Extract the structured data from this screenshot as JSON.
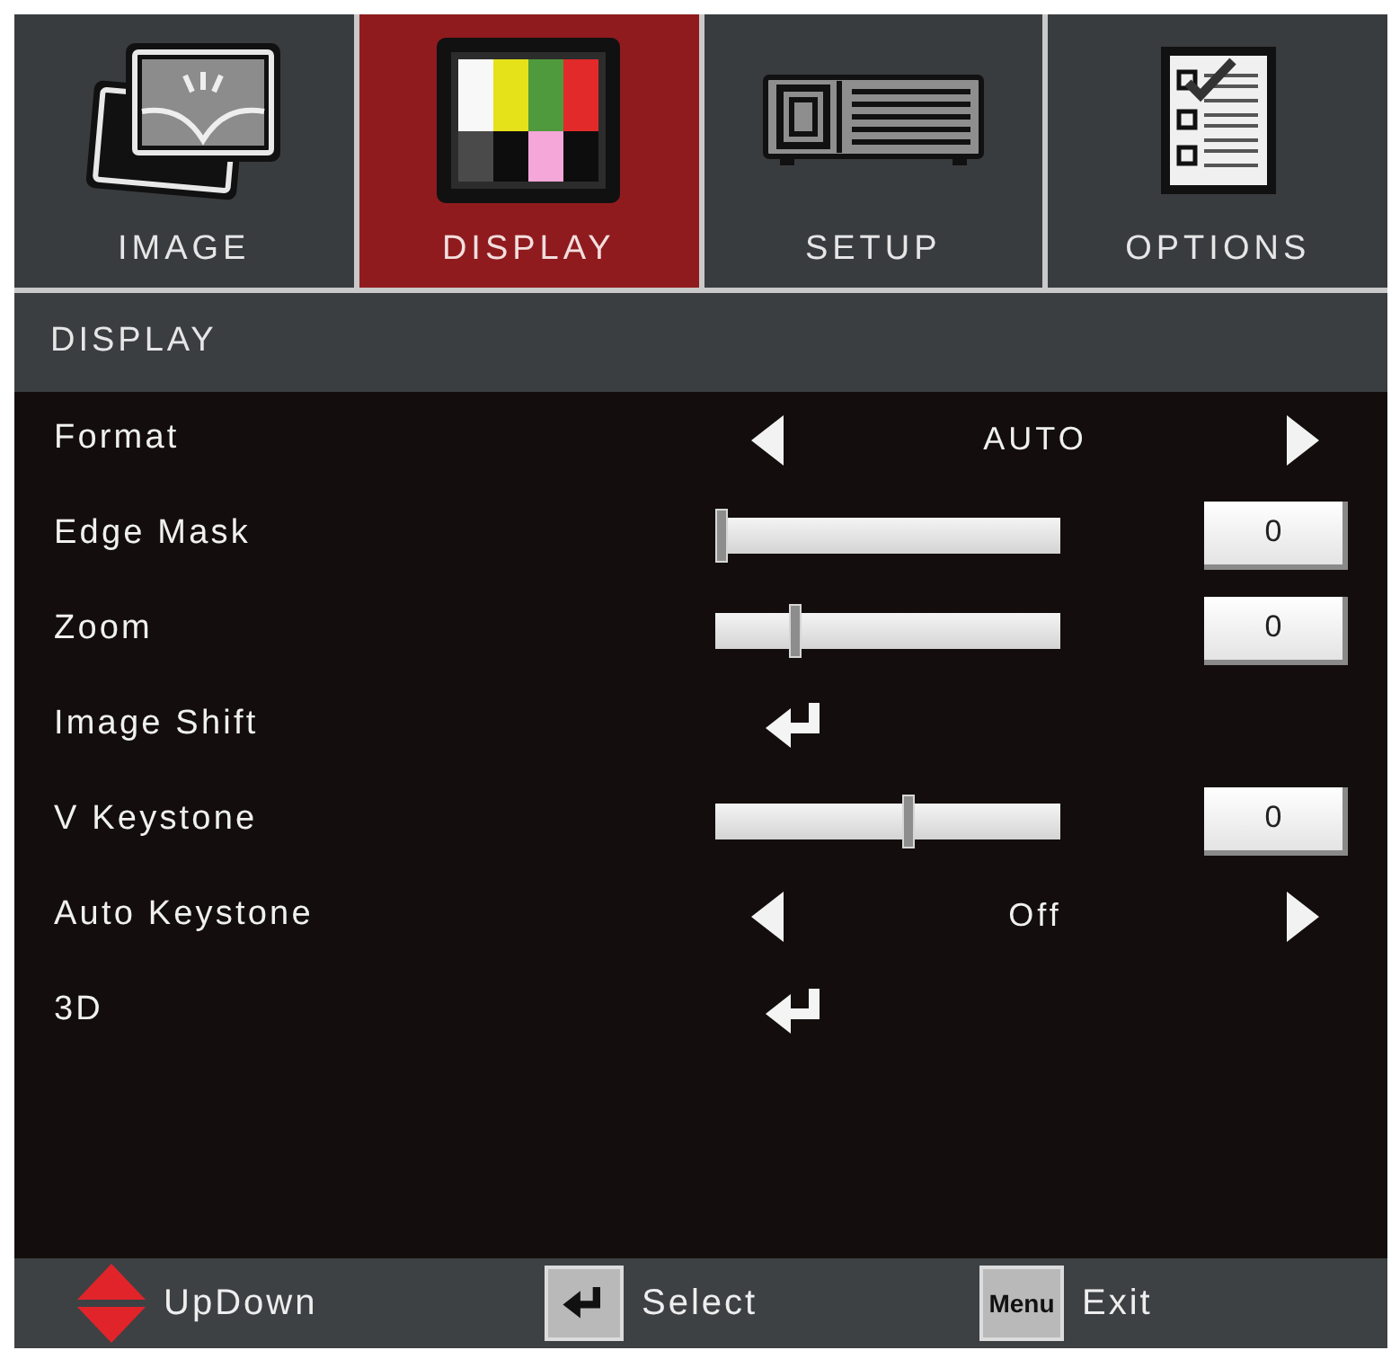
{
  "tabs": [
    {
      "label": "IMAGE",
      "selected": false
    },
    {
      "label": "DISPLAY",
      "selected": true
    },
    {
      "label": "SETUP",
      "selected": false
    },
    {
      "label": "OPTIONS",
      "selected": false
    }
  ],
  "section_title": "DISPLAY",
  "rows": [
    {
      "kind": "choice",
      "label": "Format",
      "value": "AUTO"
    },
    {
      "kind": "slider",
      "label": "Edge Mask",
      "level": 0,
      "value": "0"
    },
    {
      "kind": "slider",
      "label": "Zoom",
      "level": 0.22,
      "value": "0"
    },
    {
      "kind": "submenu",
      "label": "Image Shift"
    },
    {
      "kind": "slider",
      "label": "V Keystone",
      "level": 0.56,
      "value": "0"
    },
    {
      "kind": "choice",
      "label": "Auto Keystone",
      "value": "Off"
    },
    {
      "kind": "submenu",
      "label": "3D"
    }
  ],
  "footer": [
    {
      "kind": "updown",
      "label": "UpDown"
    },
    {
      "kind": "enter",
      "label": "Select"
    },
    {
      "kind": "key",
      "key": "Menu",
      "label": "Exit"
    }
  ]
}
